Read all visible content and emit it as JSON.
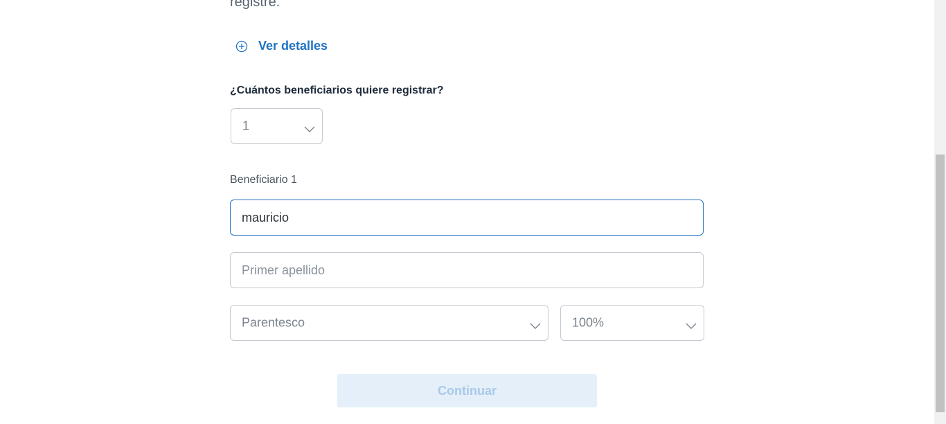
{
  "intro": {
    "text": "registre."
  },
  "details_link": {
    "label": "Ver detalles"
  },
  "beneficiary_count": {
    "question": "¿Cuántos beneficiarios quiere registrar?",
    "selected": "1"
  },
  "beneficiary": {
    "heading": "Beneficiario 1",
    "first_name_value": "mauricio",
    "last_name_placeholder": "Primer apellido",
    "relationship_placeholder": "Parentesco",
    "percentage_value": "100%"
  },
  "actions": {
    "continue_label": "Continuar"
  },
  "colors": {
    "accent": "#1f72c4",
    "button_disabled_bg": "#e4eff9",
    "button_disabled_text": "#a9c9e8"
  },
  "icons": {
    "details": "plus-circle-icon",
    "dropdown": "chevron-down-icon"
  }
}
